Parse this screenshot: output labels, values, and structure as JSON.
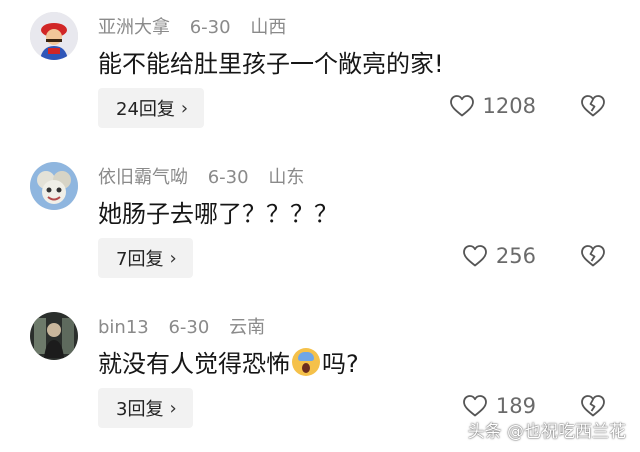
{
  "comments": [
    {
      "username": "亚洲大拿",
      "date": "6-30",
      "location": "山西",
      "text": "能不能给肚里孩子一个敞亮的家!",
      "reply_label": "24回复",
      "likes": "1208",
      "avatar_icon": "mario-avatar"
    },
    {
      "username": "依旧霸气呦",
      "date": "6-30",
      "location": "山东",
      "text": "她肠子去哪了？？？？",
      "reply_label": "7回复",
      "likes": "256",
      "avatar_icon": "cartoon-avatar"
    },
    {
      "username": "bin13",
      "date": "6-30",
      "location": "云南",
      "text_before": "就没有人觉得恐怖",
      "emoji": "scream-emoji",
      "text_after": "吗?",
      "reply_label": "3回复",
      "likes": "189",
      "avatar_icon": "dark-photo-avatar"
    }
  ],
  "watermark": "头条 @也祝吃西兰花"
}
